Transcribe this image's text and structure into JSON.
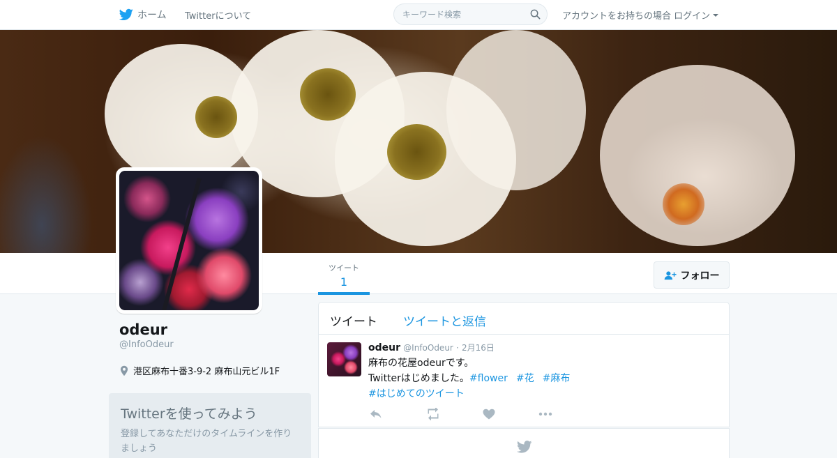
{
  "nav": {
    "home_label": "ホーム",
    "about_label": "Twitterについて",
    "search_placeholder": "キーワード検索",
    "login_label": "アカウントをお持ちの場合 ログイン"
  },
  "profile": {
    "name": "odeur",
    "handle": "@InfoOdeur",
    "location": "港区麻布十番3-9-2 麻布山元ビル1F",
    "stats": [
      {
        "label": "ツイート",
        "value": "1"
      }
    ],
    "follow_label": "フォロー"
  },
  "signup": {
    "title": "Twitterを使ってみよう",
    "description": "登録してあなただけのタイムラインを作りましょう"
  },
  "timeline": {
    "tabs": [
      {
        "label": "ツイート"
      },
      {
        "label": "ツイートと返信"
      }
    ],
    "tweets": [
      {
        "name": "odeur",
        "handle": "@InfoOdeur",
        "separator": "·",
        "date": "2月16日",
        "line1": "麻布の花屋odeurです。",
        "line2": "Twitterはじめました。",
        "hashtags": [
          "#flower",
          "#花",
          "#麻布",
          "#はじめてのツイート"
        ]
      }
    ]
  },
  "icons": {
    "nav_home": "bird-icon",
    "search": "search-icon",
    "location": "map-pin-icon",
    "follow": "person-add-icon",
    "reply": "reply-icon",
    "retweet": "retweet-icon",
    "like": "heart-icon",
    "more": "more-icon",
    "footer": "bird-icon"
  },
  "colors": {
    "accent": "#1b95e0",
    "text": "#14171a",
    "muted": "#8899a6",
    "background": "#f5f8fa",
    "border": "#e1e8ed"
  }
}
